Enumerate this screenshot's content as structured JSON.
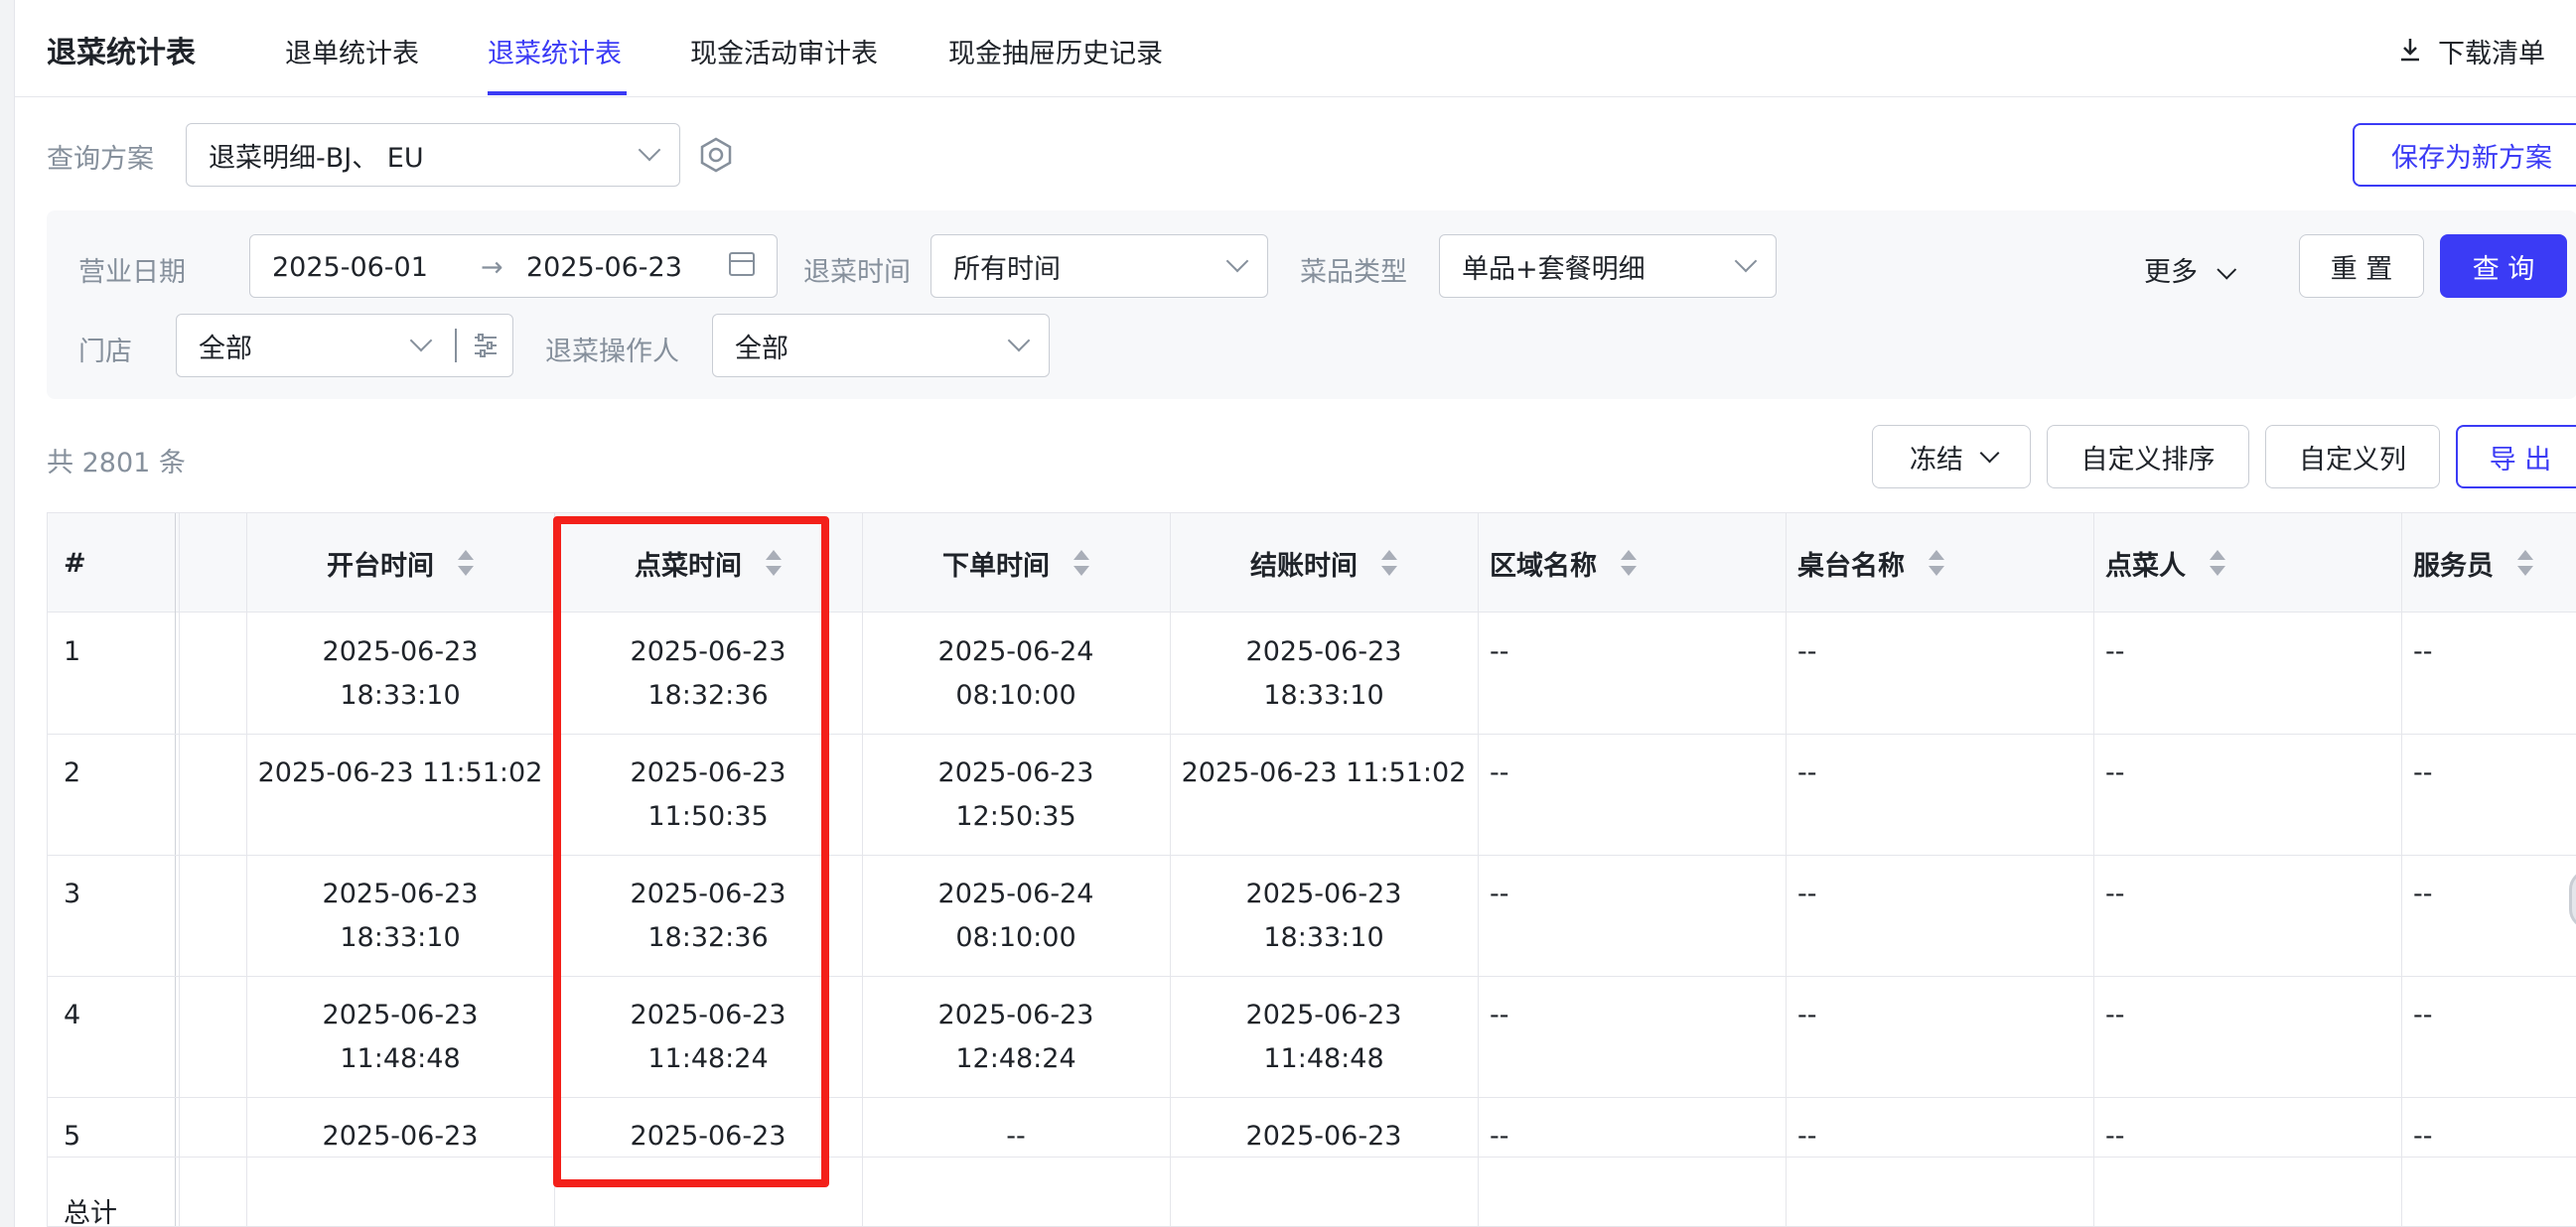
{
  "app_title": "退菜统计表",
  "tabs": [
    {
      "label": "退单统计表",
      "active": false
    },
    {
      "label": "退菜统计表",
      "active": true
    },
    {
      "label": "现金活动审计表",
      "active": false
    },
    {
      "label": "现金抽屉历史记录",
      "active": false
    }
  ],
  "download_label": "下载清单",
  "query_scheme": {
    "label": "查询方案",
    "value": "退菜明细-BJ、 EU",
    "save_new_label": "保存为新方案"
  },
  "filters": {
    "business_date": {
      "label": "营业日期",
      "start": "2025-06-01",
      "end": "2025-06-23",
      "separator": "→"
    },
    "return_time": {
      "label": "退菜时间",
      "value": "所有时间"
    },
    "dish_type": {
      "label": "菜品类型",
      "value": "单品+套餐明细"
    },
    "more_label": "更多",
    "reset_label": "重 置",
    "query_label": "查 询",
    "store": {
      "label": "门店",
      "value": "全部"
    },
    "operator": {
      "label": "退菜操作人",
      "value": "全部"
    }
  },
  "toolbar": {
    "count": "共 2801 条",
    "freeze_label": "冻结",
    "custom_sort_label": "自定义排序",
    "custom_columns_label": "自定义列",
    "export_label": "导 出"
  },
  "table": {
    "columns": [
      "#",
      "开台时间",
      "点菜时间",
      "下单时间",
      "结账时间",
      "区域名称",
      "桌台名称",
      "点菜人",
      "服务员"
    ],
    "rows": [
      {
        "idx": "1",
        "open": [
          "2025-06-23",
          "18:33:10"
        ],
        "order_dish": [
          "2025-06-23",
          "18:32:36"
        ],
        "place": [
          "2025-06-24",
          "08:10:00"
        ],
        "checkout": [
          "2025-06-23",
          "18:33:10"
        ],
        "area": "--",
        "table": "--",
        "orderer": "--",
        "waiter": "--"
      },
      {
        "idx": "2",
        "open": [
          "2025-06-23 11:51:02",
          ""
        ],
        "order_dish": [
          "2025-06-23",
          "11:50:35"
        ],
        "place": [
          "2025-06-23",
          "12:50:35"
        ],
        "checkout": [
          "2025-06-23 11:51:02",
          ""
        ],
        "area": "--",
        "table": "--",
        "orderer": "--",
        "waiter": "--"
      },
      {
        "idx": "3",
        "open": [
          "2025-06-23",
          "18:33:10"
        ],
        "order_dish": [
          "2025-06-23",
          "18:32:36"
        ],
        "place": [
          "2025-06-24",
          "08:10:00"
        ],
        "checkout": [
          "2025-06-23",
          "18:33:10"
        ],
        "area": "--",
        "table": "--",
        "orderer": "--",
        "waiter": "--"
      },
      {
        "idx": "4",
        "open": [
          "2025-06-23",
          "11:48:48"
        ],
        "order_dish": [
          "2025-06-23",
          "11:48:24"
        ],
        "place": [
          "2025-06-23",
          "12:48:24"
        ],
        "checkout": [
          "2025-06-23",
          "11:48:48"
        ],
        "area": "--",
        "table": "--",
        "orderer": "--",
        "waiter": "--"
      },
      {
        "idx": "5",
        "open": [
          "2025-06-23",
          ""
        ],
        "order_dish": [
          "2025-06-23",
          ""
        ],
        "place": [
          "--",
          ""
        ],
        "checkout": [
          "2025-06-23",
          ""
        ],
        "area": "--",
        "table": "--",
        "orderer": "--",
        "waiter": "--"
      }
    ],
    "total_label": "总计"
  },
  "colors": {
    "accent": "#3b3bf5",
    "highlight": "#f3201a"
  }
}
